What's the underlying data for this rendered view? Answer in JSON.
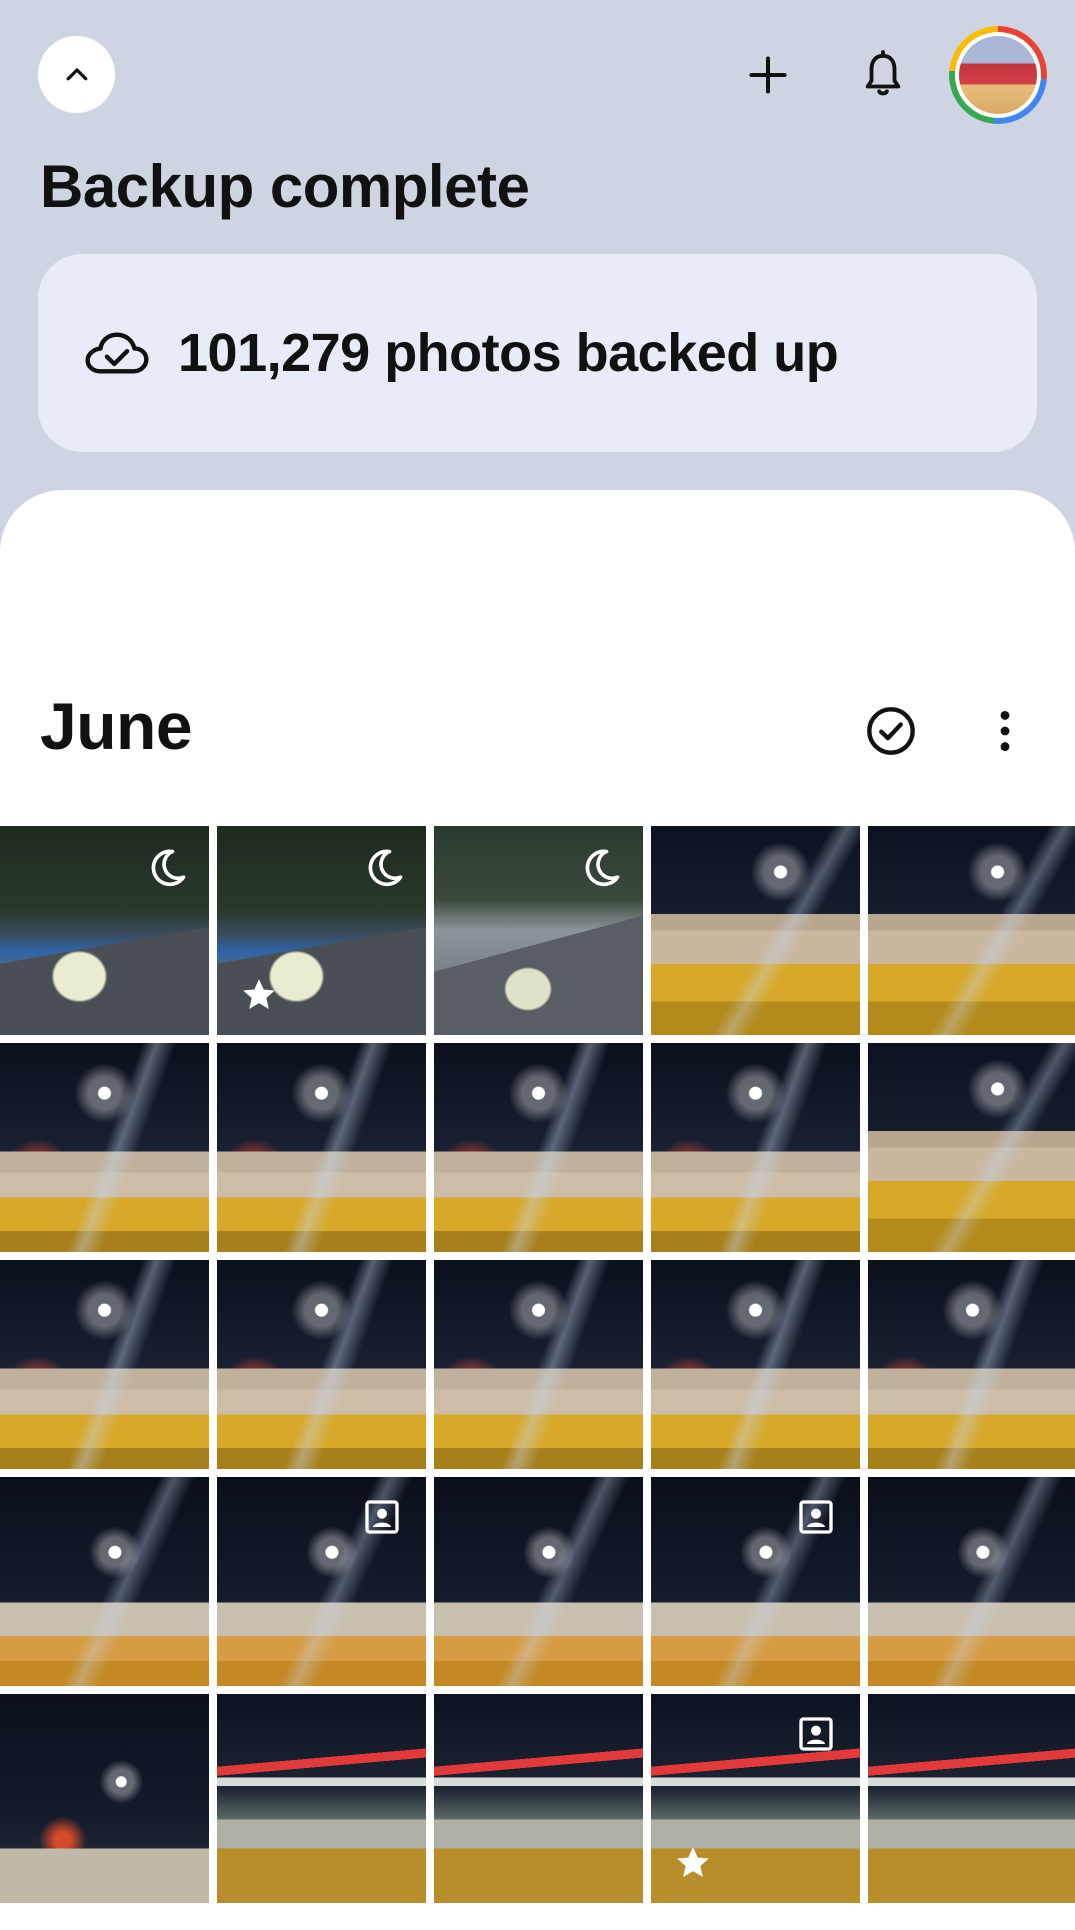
{
  "header": {
    "collapse_icon": "chevron-up-icon",
    "add_icon": "plus-icon",
    "notifications_icon": "bell-icon",
    "avatar_colors": [
      "#ea4335",
      "#4285f4",
      "#34a853",
      "#fbbc05"
    ]
  },
  "backup": {
    "title": "Backup complete",
    "status_icon": "cloud-check-icon",
    "status_text": "101,279 photos backed up"
  },
  "section": {
    "month": "June",
    "select_icon": "check-circle-icon",
    "more_icon": "more-vert-icon"
  },
  "photos": [
    {
      "style": "p-car",
      "badge": "night-icon",
      "favorite": false
    },
    {
      "style": "p-car",
      "badge": "night-icon",
      "favorite": true
    },
    {
      "style": "p-car2",
      "badge": "night-icon",
      "favorite": false
    },
    {
      "style": "p-cup",
      "badge": "",
      "favorite": false
    },
    {
      "style": "p-cup",
      "badge": "",
      "favorite": false
    },
    {
      "style": "p-cup2",
      "badge": "",
      "favorite": false
    },
    {
      "style": "p-cup2",
      "badge": "",
      "favorite": false
    },
    {
      "style": "p-cup2",
      "badge": "",
      "favorite": false
    },
    {
      "style": "p-cup2",
      "badge": "",
      "favorite": false
    },
    {
      "style": "p-cup",
      "badge": "",
      "favorite": false
    },
    {
      "style": "p-cup2",
      "badge": "",
      "favorite": false
    },
    {
      "style": "p-cup2",
      "badge": "",
      "favorite": false
    },
    {
      "style": "p-cup2",
      "badge": "",
      "favorite": false
    },
    {
      "style": "p-cup2",
      "badge": "",
      "favorite": false
    },
    {
      "style": "p-cup2",
      "badge": "",
      "favorite": false
    },
    {
      "style": "p-cup3",
      "badge": "",
      "favorite": false
    },
    {
      "style": "p-cup3",
      "badge": "portrait-icon",
      "favorite": false
    },
    {
      "style": "p-cup3",
      "badge": "",
      "favorite": false
    },
    {
      "style": "p-cup3",
      "badge": "portrait-icon",
      "favorite": false
    },
    {
      "style": "p-cup3",
      "badge": "",
      "favorite": false
    },
    {
      "style": "p-cup4",
      "badge": "",
      "favorite": false
    },
    {
      "style": "p-gas",
      "badge": "",
      "favorite": false
    },
    {
      "style": "p-gas",
      "badge": "",
      "favorite": false
    },
    {
      "style": "p-gas",
      "badge": "portrait-icon",
      "favorite": true
    },
    {
      "style": "p-gas",
      "badge": "",
      "favorite": false
    }
  ]
}
